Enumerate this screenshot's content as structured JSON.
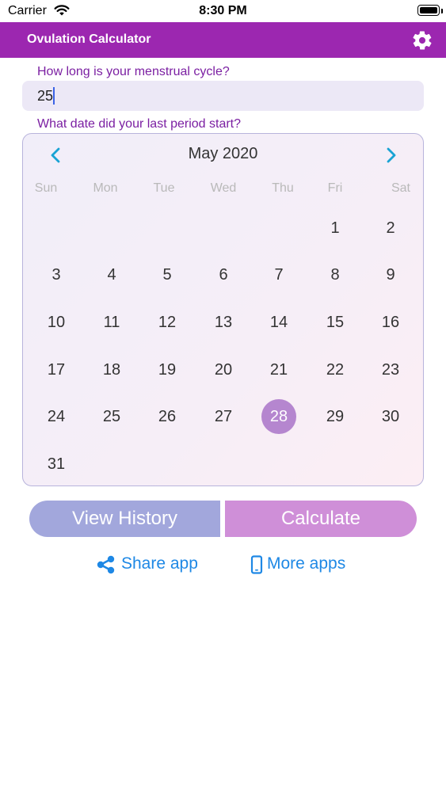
{
  "status_bar": {
    "carrier": "Carrier",
    "time": "8:30 PM"
  },
  "header": {
    "title": "Ovulation Calculator"
  },
  "form": {
    "cycle_question": "How long is your menstrual cycle?",
    "cycle_value": "25",
    "date_question": "What date did your last period start?"
  },
  "calendar": {
    "month_label": "May 2020",
    "weekdays": [
      "Sun",
      "Mon",
      "Tue",
      "Wed",
      "Thu",
      "Fri",
      "Sat"
    ],
    "first_weekday_index": 5,
    "days_in_month": 31,
    "selected_day": 28
  },
  "buttons": {
    "history": "View History",
    "calculate": "Calculate"
  },
  "links": {
    "share": "Share app",
    "more": "More apps"
  },
  "colors": {
    "header": "#9c27b0",
    "label": "#7b1fa2",
    "link": "#1e88e5",
    "selected_day": "#b586cf",
    "history_button": "#a2a7dc",
    "calculate_button": "#cf8fd8"
  }
}
